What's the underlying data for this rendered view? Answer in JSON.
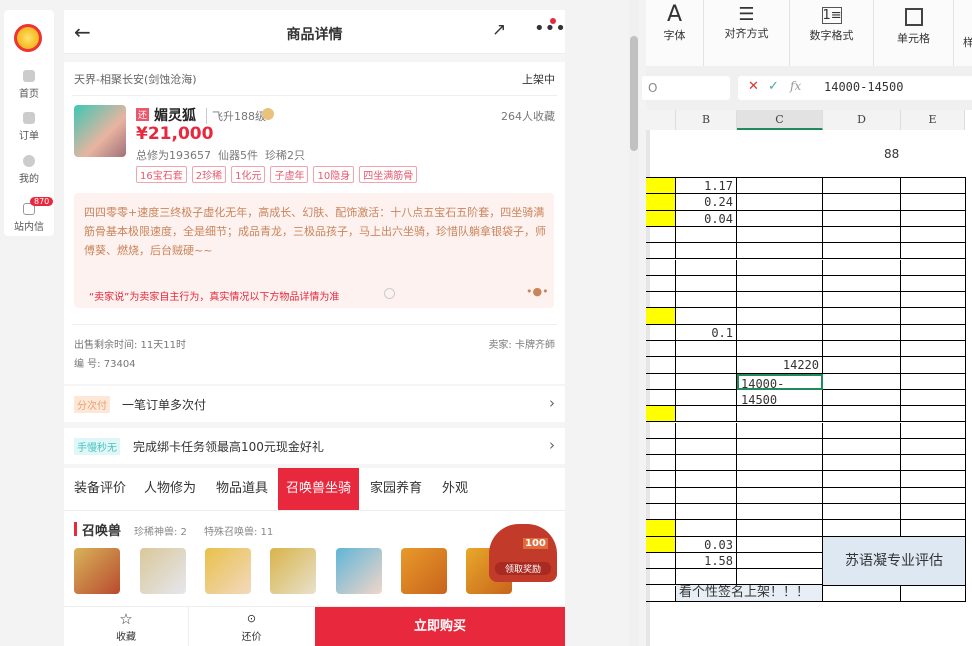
{
  "sidebar": {
    "items": [
      {
        "label": "首页"
      },
      {
        "label": "订单"
      },
      {
        "label": "我的"
      },
      {
        "label": "站内信",
        "badge": "870"
      }
    ]
  },
  "header": {
    "title": "商品详情"
  },
  "server": "天界-相聚长安(剑蚀沧海)",
  "status": "上架中",
  "product": {
    "badge": "还",
    "name": "媚灵狐",
    "level": "飞升188级",
    "favorites": "264人收藏",
    "price": "¥21,000",
    "stats": "总修为193657  仙器5件  珍稀2只",
    "tags": [
      "16宝石套",
      "2珍稀",
      "1化元",
      "子虚年",
      "10隐身",
      "四坐满筋骨"
    ]
  },
  "seller_note": {
    "text": "四四零零+速度三终极子虚化无年，高成长、幻肤、配饰激活：十八点五宝石五阶套，四坐骑满筋骨基本极限速度，全是细节；成品青龙，三极品孩子，马上出六坐骑，珍惜队躺拿银袋子，师傅葵、燃烧，后台贼硬~~",
    "disclaimer": "“卖家说”为卖家自主行为，真实情况以下方物品详情为准"
  },
  "sale": {
    "remaining": "出售剩余时间: 11天11时",
    "seller": "卖家: 卡牌齐師",
    "id": "编 号: 73404"
  },
  "promos": [
    {
      "tag": "分次付",
      "text": "一笔订单多次付"
    },
    {
      "tag": "手慢秒无",
      "text": "完成绑卡任务领最高100元现金好礼"
    }
  ],
  "tabs": [
    "装备评价",
    "人物修为",
    "物品道具",
    "召唤兽坐骑",
    "家园养育",
    "外观"
  ],
  "section": {
    "title": "召唤兽",
    "rare": "珍稀神兽: 2",
    "special": "特殊召唤兽: 11"
  },
  "reward": {
    "amount": "100",
    "label": "领取奖励"
  },
  "bottom": {
    "fav": "收藏",
    "bargain": "还价",
    "buy": "立即购买"
  },
  "excel": {
    "ribbon": [
      "字体",
      "对齐方式",
      "数字格式",
      "单元格",
      "样"
    ],
    "namebox": "O",
    "formula": "14000-14500",
    "columns": [
      "B",
      "C",
      "D",
      "E"
    ],
    "cells": {
      "r0": "88",
      "b1": "1.17",
      "b2": "0.24",
      "b3": "0.04",
      "b10": "0.1",
      "c12": "14220",
      "c13": "14000-14500",
      "b23": "0.03",
      "b24": "1.58",
      "note": "苏语凝专业评估",
      "sign": "看个性签名上架！！！"
    }
  },
  "colors": {
    "accent": "#e8283c",
    "yellow": "#ffff00",
    "note_bg": "#dde8f3"
  }
}
